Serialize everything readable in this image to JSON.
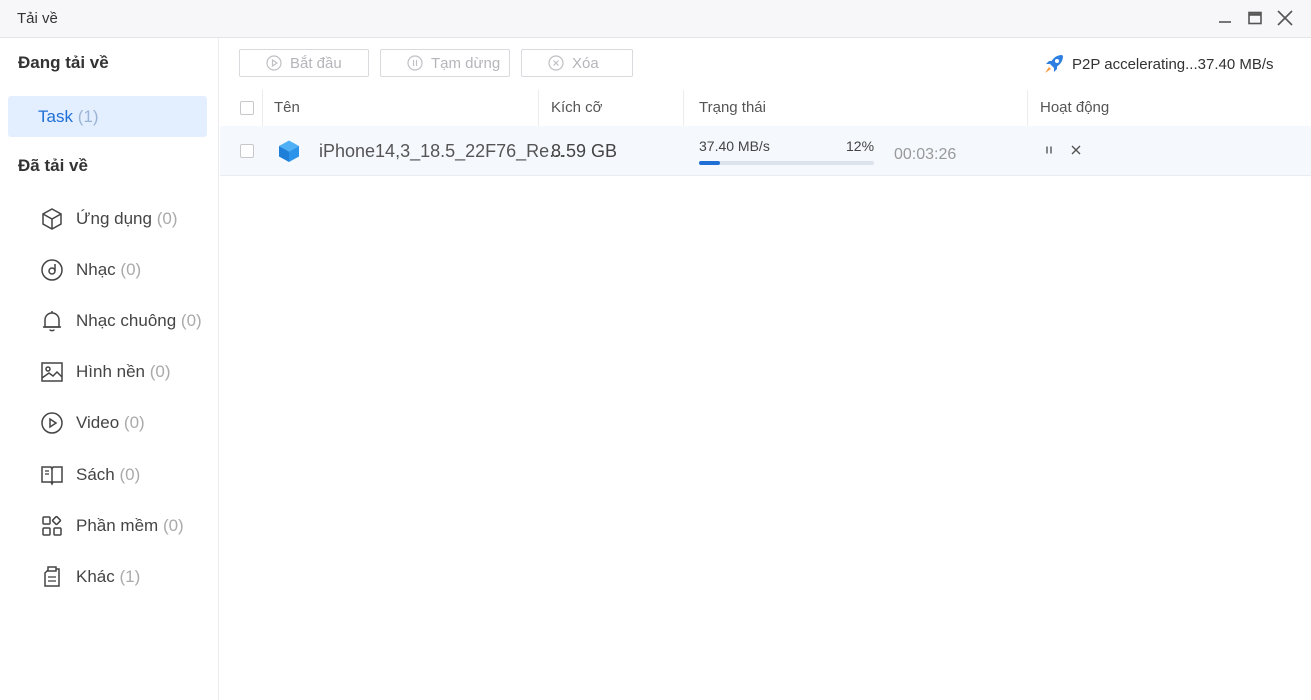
{
  "window": {
    "title": "Tải về"
  },
  "sidebar": {
    "downloading_title": "Đang tải về",
    "task": {
      "label": "Task",
      "count": "(1)"
    },
    "downloaded_title": "Đã tải về",
    "items": [
      {
        "label": "Ứng dụng",
        "count": "(0)",
        "icon": "app-cube-icon"
      },
      {
        "label": "Nhạc",
        "count": "(0)",
        "icon": "music-disc-icon"
      },
      {
        "label": "Nhạc chuông",
        "count": "(0)",
        "icon": "bell-icon"
      },
      {
        "label": "Hình nền",
        "count": "(0)",
        "icon": "image-icon"
      },
      {
        "label": "Video",
        "count": "(0)",
        "icon": "play-circle-icon"
      },
      {
        "label": "Sách",
        "count": "(0)",
        "icon": "book-icon"
      },
      {
        "label": "Phần mềm",
        "count": "(0)",
        "icon": "grid-apps-icon"
      },
      {
        "label": "Khác",
        "count": "(1)",
        "icon": "clipboard-icon"
      }
    ]
  },
  "toolbar": {
    "start_label": "Bắt đầu",
    "pause_label": "Tạm dừng",
    "delete_label": "Xóa",
    "p2p_text": "P2P accelerating...37.40 MB/s"
  },
  "table": {
    "headers": {
      "name": "Tên",
      "size": "Kích cỡ",
      "status": "Trạng thái",
      "action": "Hoạt động"
    },
    "rows": [
      {
        "name": "iPhone14,3_18.5_22F76_Re...",
        "size": "8.59 GB",
        "speed": "37.40 MB/s",
        "percent": "12%",
        "progress": 0.12,
        "eta": "00:03:26"
      }
    ]
  },
  "colors": {
    "accent": "#1f6fd6",
    "selected_bg": "#e3efff",
    "row_bg": "#f5f8fd"
  }
}
